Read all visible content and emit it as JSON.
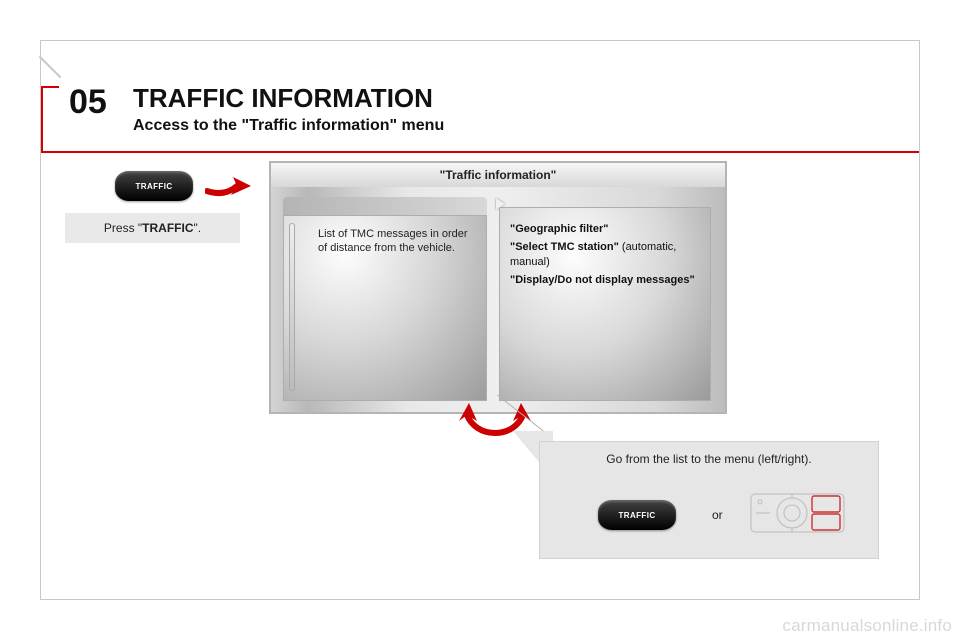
{
  "section_number": "05",
  "header": {
    "title": "TRAFFIC INFORMATION",
    "subtitle": "Access to the \"Traffic information\" menu"
  },
  "button_label": "TRAFFIC",
  "instruction": {
    "prefix": "Press \"",
    "bold": "TRAFFIC",
    "suffix": "\"."
  },
  "screen": {
    "title": "\"Traffic information\"",
    "left_pane": "List of TMC messages in order of distance from the vehicle.",
    "right_pane": {
      "opt1": "\"Geographic filter\"",
      "opt2": "\"Select TMC station\"",
      "opt2_sub": "(automatic, manual)",
      "opt3": "\"Display/Do not display messages\""
    }
  },
  "callout": {
    "text": "Go from the list to the menu (left/right).",
    "or": "or",
    "button_label": "TRAFFIC"
  },
  "watermark": "carmanualsonline.info"
}
